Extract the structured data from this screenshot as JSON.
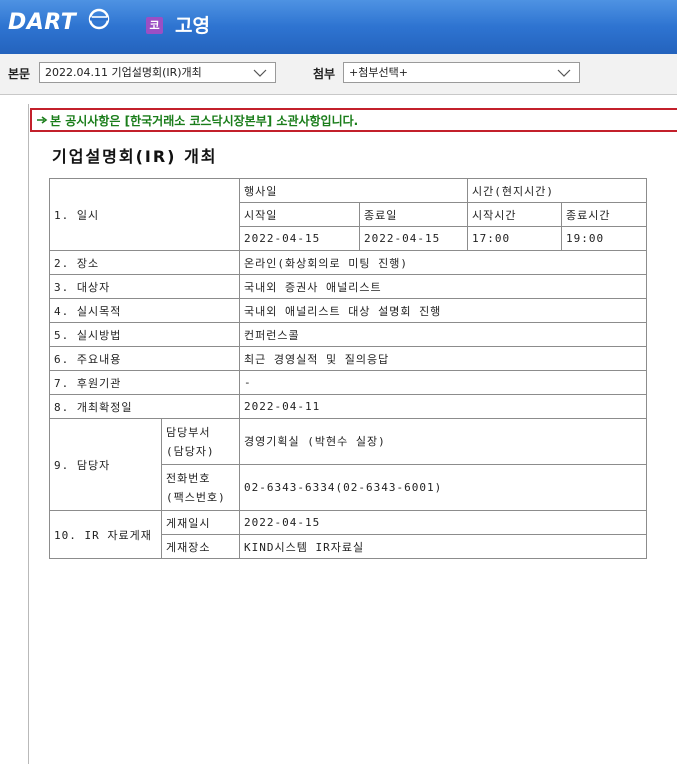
{
  "header": {
    "logo_text": "DART",
    "corp_badge": "코",
    "corp_name": "고영"
  },
  "toolbar": {
    "main_label": "본문",
    "main_select": "2022.04.11  기업설명회(IR)개최",
    "attach_label": "첨부",
    "attach_select": "+첨부선택+"
  },
  "notice": {
    "text": "본 공시사항은 [한국거래소 코스닥시장본부] 소관사항입니다."
  },
  "document": {
    "title": "기업설명회(IR) 개최",
    "table": {
      "row1": {
        "label": "1. 일시",
        "event_date_header": "행사일",
        "time_header": "시간(현지시간)",
        "start_date_header": "시작일",
        "end_date_header": "종료일",
        "start_time_header": "시작시간",
        "end_time_header": "종료시간",
        "start_date": "2022-04-15",
        "end_date": "2022-04-15",
        "start_time": "17:00",
        "end_time": "19:00"
      },
      "rows": [
        {
          "label": "2. 장소",
          "value": "온라인(화상회의로 미팅 진행)"
        },
        {
          "label": "3. 대상자",
          "value": "국내외 증권사 애널리스트"
        },
        {
          "label": "4. 실시목적",
          "value": "국내외 애널리스트 대상 설명회 진행"
        },
        {
          "label": "5. 실시방법",
          "value": "컨퍼런스콜"
        },
        {
          "label": "6. 주요내용",
          "value": "최근 경영실적 및 질의응답"
        },
        {
          "label": "7. 후원기관",
          "value": "-"
        },
        {
          "label": "8. 개최확정일",
          "value": "2022-04-11"
        }
      ],
      "contact": {
        "label": "9. 담당자",
        "dept_label_1": "담당부서",
        "dept_label_2": "(담당자)",
        "dept_value": "경영기획실 (박현수 실장)",
        "phone_label_1": "전화번호",
        "phone_label_2": "(팩스번호)",
        "phone_value": "02-6343-6334(02-6343-6001)"
      },
      "ir_posting": {
        "label": "10. IR 자료게재",
        "date_label": "게재일시",
        "date_value": "2022-04-15",
        "place_label": "게재장소",
        "place_value": "KIND시스템 IR자료실"
      }
    }
  },
  "colors": {
    "header_blue": "#2d72cf",
    "notice_border": "#c3202b",
    "notice_text": "#1a7d1a",
    "corp_badge": "#9b4fc4"
  }
}
